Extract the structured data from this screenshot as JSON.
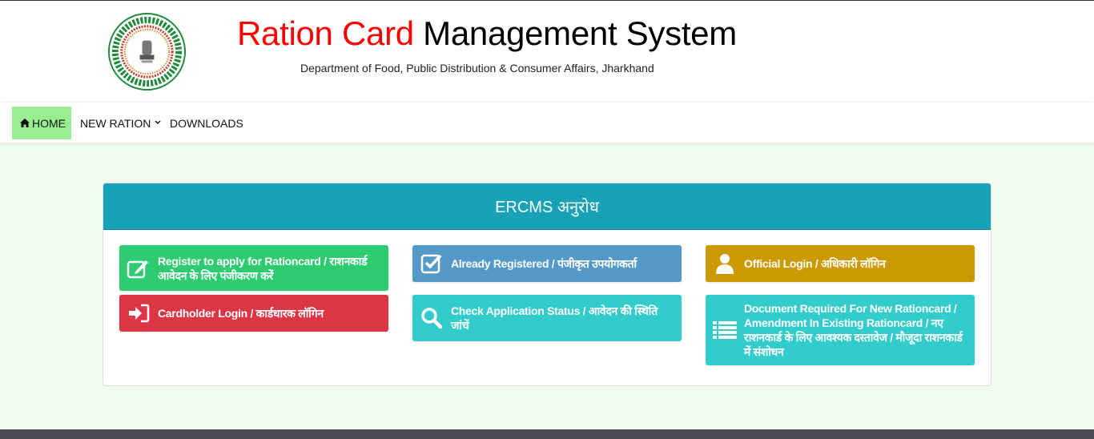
{
  "header": {
    "logo_alt": "Government of Jharkhand emblem",
    "title_red": "Ration Card",
    "title_black": " Management System",
    "subtitle": "Department of Food, Public Distribution & Consumer Affairs, Jharkhand"
  },
  "nav": {
    "items": [
      {
        "label": "HOME",
        "icon": "home-icon",
        "active": true
      },
      {
        "label": "NEW RATION",
        "icon": "chevron-down-icon"
      },
      {
        "label": "DOWNLOADS"
      }
    ],
    "active_color": "#98ee90"
  },
  "panel": {
    "title": "ERCMS अनुरोध",
    "header_color": "#17a2b8",
    "buttons": [
      {
        "label": "Register to apply for Rationcard / राशनकार्ड आवेदन के लिए पंजीकरण करें",
        "icon": "edit-icon",
        "color": "#2ecc71"
      },
      {
        "label": "Cardholder Login / कार्डधारक लॉगिन",
        "icon": "sign-in-icon",
        "color": "#dc3545"
      },
      {
        "label": "Already Registered / पंजीकृत उपयोगकर्ता",
        "icon": "check-square-icon",
        "color": "#5499c7"
      },
      {
        "label": "Check Application Status / आवेदन की स्थिति जांचें",
        "icon": "search-icon",
        "color": "#33cccc"
      },
      {
        "label": "Official Login / अधिकारी लॉगिन",
        "icon": "user-icon",
        "color": "#cc9a00"
      },
      {
        "label": "Document Required For New Rationcard / Amendment In Existing Rationcard / नए राशनकार्ड के लिए आवश्यक दस्तावेज / मौजूदा राशनकार्ड में संशोधन",
        "icon": "list-icon",
        "color": "#33cccc"
      }
    ]
  }
}
